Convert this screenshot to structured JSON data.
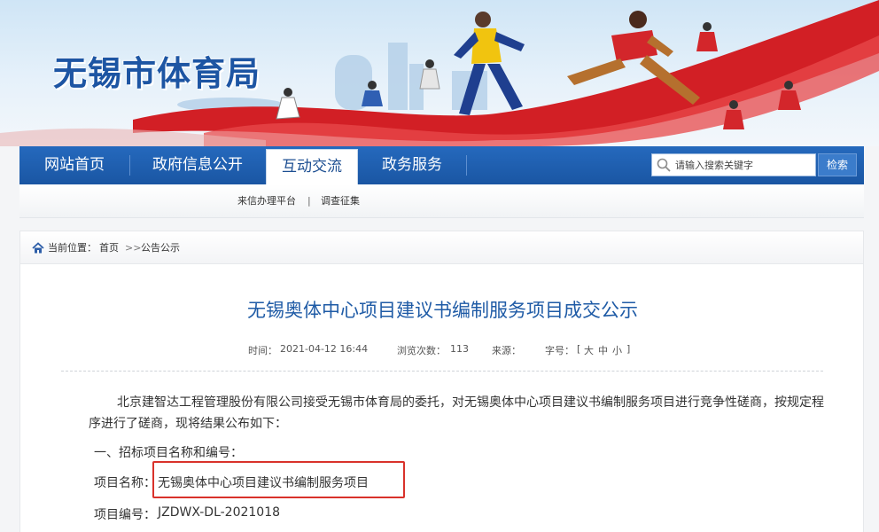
{
  "site": {
    "title": "无锡市体育局"
  },
  "nav": {
    "items": [
      {
        "label": "网站首页",
        "active": false
      },
      {
        "label": "政府信息公开",
        "active": false
      },
      {
        "label": "互动交流",
        "active": true
      },
      {
        "label": "政务服务",
        "active": false
      }
    ],
    "search_placeholder": "请输入搜索关键字",
    "search_button": "检索"
  },
  "subnav": {
    "items": [
      "来信办理平台",
      "调查征集"
    ],
    "separator": "|"
  },
  "breadcrumb": {
    "label": "当前位置：",
    "home": "首页",
    "separator": ">>",
    "current": "公告公示"
  },
  "article": {
    "title": "无锡奥体中心项目建议书编制服务项目成交公示",
    "meta": {
      "time_label": "时间：",
      "time": "2021-04-12 16:44",
      "views_label": "浏览次数：",
      "views": "113",
      "source_label": "来源：",
      "source": "",
      "fontsize_label": "字号：",
      "fontsize_open": "[",
      "fontsize_large": "大",
      "fontsize_medium": "中",
      "fontsize_small": "小",
      "fontsize_close": "]"
    },
    "intro": "北京建智达工程管理股份有限公司接受无锡市体育局的委托，对无锡奥体中心项目建议书编制服务项目进行竞争性磋商，按规定程序进行了磋商，现将结果公布如下：",
    "section1": "一、招标项目名称和编号：",
    "project_name_label": "项目名称：",
    "project_name": "无锡奥体中心项目建议书编制服务项目",
    "project_no_label": "项目编号：",
    "project_no": "JZDWX-DL-2021018"
  },
  "colors": {
    "brand_blue": "#1d55a3",
    "nav_blue": "#1a56a3",
    "title_blue": "#1f5ba6",
    "highlight_red": "#d9322b",
    "ribbon_red": "#d21f25"
  }
}
